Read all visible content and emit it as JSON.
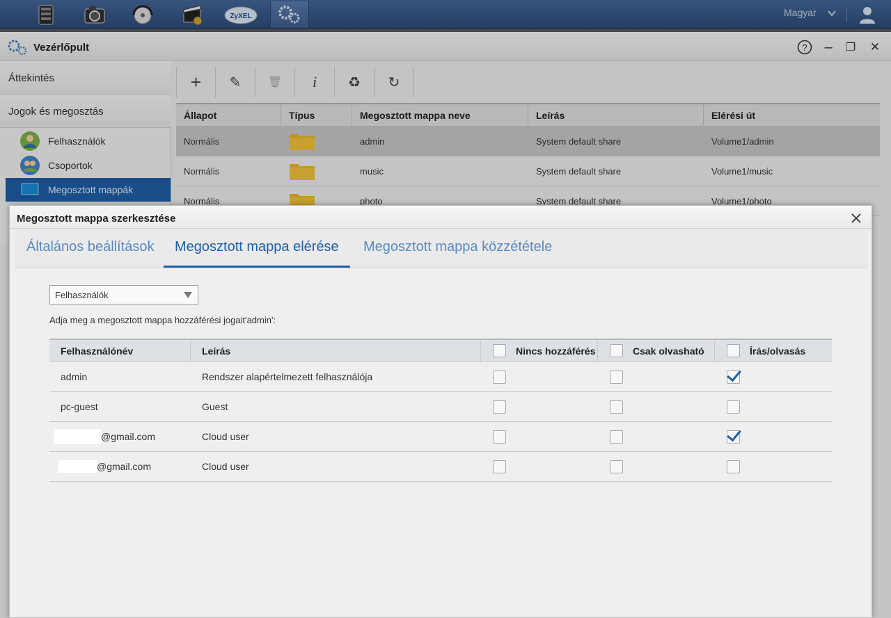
{
  "taskbar": {
    "apps": [
      {
        "icon": "file-manager-icon"
      },
      {
        "icon": "photo-icon"
      },
      {
        "icon": "music-icon"
      },
      {
        "icon": "video-icon"
      },
      {
        "icon": "zyxel-cloud-icon",
        "label": "ZyXEL"
      },
      {
        "icon": "control-panel-icon"
      }
    ],
    "language": "Magyar",
    "user_icon": "user-icon"
  },
  "window": {
    "title": "Vezérlőpult",
    "controls": {
      "help": "?",
      "minimize": "–",
      "maximize": "❐",
      "close": "✕"
    }
  },
  "sidebar": {
    "overview": "Áttekintés",
    "rights_section": "Jogok és megosztás",
    "items": [
      {
        "label": "Felhasználók",
        "icon": "users-icon"
      },
      {
        "label": "Csoportok",
        "icon": "groups-icon"
      },
      {
        "label": "Megosztott mappák",
        "icon": "shared-folders-icon",
        "active": true
      }
    ]
  },
  "toolbar": {
    "buttons": [
      {
        "name": "add",
        "glyph": "+"
      },
      {
        "name": "edit",
        "glyph": "✎"
      },
      {
        "name": "delete",
        "glyph": "🗑"
      },
      {
        "name": "info",
        "glyph": "i"
      },
      {
        "name": "recycle",
        "glyph": "♻"
      },
      {
        "name": "refresh",
        "glyph": "↻"
      }
    ]
  },
  "shares_table": {
    "columns": [
      "Állapot",
      "Típus",
      "Megosztott mappa neve",
      "Leírás",
      "Elérési út"
    ],
    "rows": [
      {
        "status": "Normális",
        "name": "admin",
        "description": "System default share",
        "path": "Volume1/admin"
      },
      {
        "status": "Normális",
        "name": "music",
        "description": "System default share",
        "path": "Volume1/music"
      },
      {
        "status": "Normális",
        "name": "photo",
        "description": "System default share",
        "path": "Volume1/photo"
      }
    ]
  },
  "dialog": {
    "title": "Megosztott mappa szerkesztése",
    "tabs": [
      "Általános beállítások",
      "Megosztott mappa elérése",
      "Megosztott mappa közzététele"
    ],
    "active_tab": 1,
    "filter_select": "Felhasználók",
    "instruction": "Adja meg a megosztott mappa hozzáférési jogait'admin':",
    "perm_table": {
      "columns": [
        "Felhasználónév",
        "Leírás",
        "Nincs hozzáférés",
        "Csak olvasható",
        "Írás/olvasás"
      ],
      "rows": [
        {
          "user": "admin",
          "description": "Rendszer alapértelmezett felhasználója",
          "none": false,
          "read": false,
          "write": true
        },
        {
          "user": "pc-guest",
          "description": "Guest",
          "none": false,
          "read": false,
          "write": false
        },
        {
          "user": "@gmail.com",
          "description": "Cloud user",
          "none": false,
          "read": false,
          "write": true
        },
        {
          "user": "@gmail.com",
          "description": "Cloud user",
          "none": false,
          "read": false,
          "write": false
        }
      ]
    }
  }
}
